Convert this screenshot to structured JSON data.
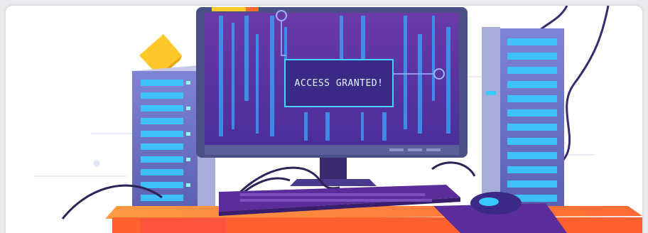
{
  "illustration": {
    "screen_message": "ACCESS GRANTED!"
  },
  "colors": {
    "background": "#ffffff",
    "monitor_bezel": "#4a4f86",
    "screen": "#7b3fb4",
    "screen_glow": "#3aa8ff",
    "message_box": "#3a2a86",
    "message_border": "#46d2ff",
    "message_text": "#dff6ff",
    "server": "#6f74c8",
    "server_side": "#a7acd8",
    "server_light": "#3ac9ff",
    "desk_top": "#ff8a47",
    "desk_front": "#ff6030",
    "keyboard": "#5b2d9a",
    "mouse": "#3a2a86",
    "sticky_note": "#ffc82a"
  },
  "icons": [
    "monitor",
    "server-tower",
    "keyboard",
    "mouse",
    "sticky-note",
    "cable"
  ]
}
